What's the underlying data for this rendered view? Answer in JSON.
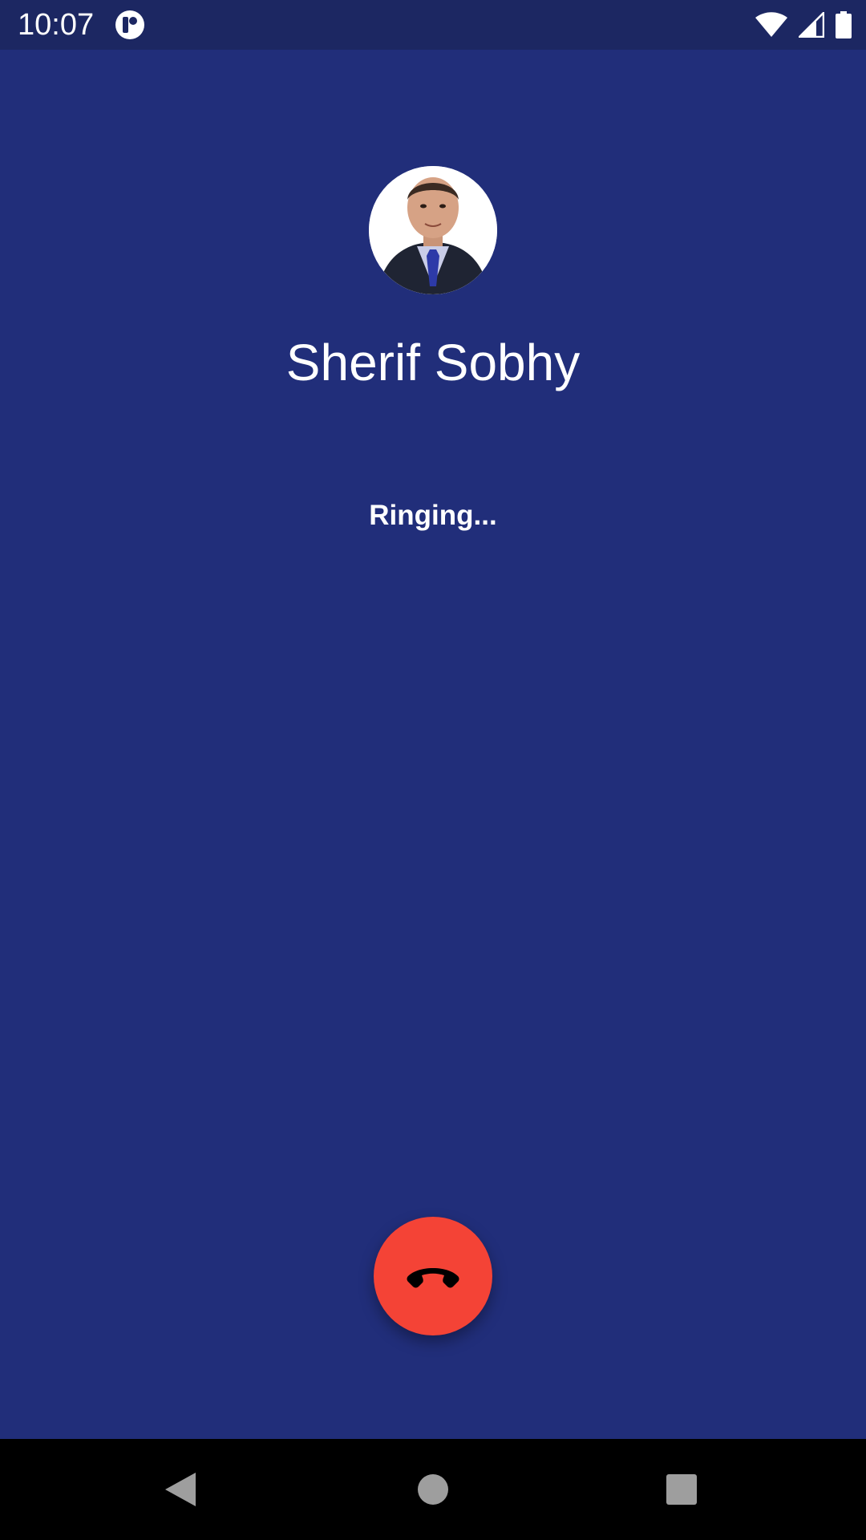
{
  "status_bar": {
    "time": "10:07",
    "icons": [
      "app-notification-icon",
      "wifi-icon",
      "cell-signal-icon",
      "battery-icon"
    ]
  },
  "call": {
    "caller_name": "Sherif Sobhy",
    "status": "Ringing...",
    "avatar_icon": "caller-avatar-photo",
    "end_call_icon": "call-end-icon"
  },
  "nav_bar": {
    "buttons": [
      "back-icon",
      "home-icon",
      "recents-icon"
    ]
  },
  "colors": {
    "background": "#212e7a",
    "status_bar": "#1c2762",
    "end_call": "#f44336",
    "nav_bar": "#000000",
    "text": "#ffffff"
  }
}
